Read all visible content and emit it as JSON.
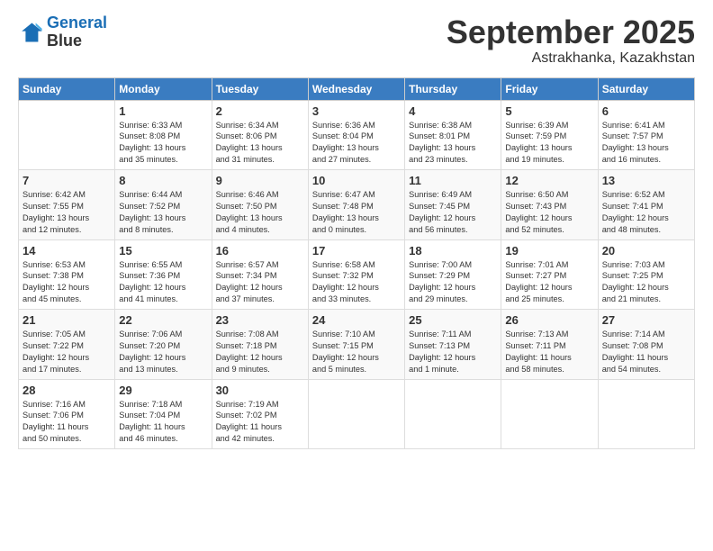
{
  "header": {
    "logo_line1": "General",
    "logo_line2": "Blue",
    "month": "September 2025",
    "location": "Astrakhanka, Kazakhstan"
  },
  "days_of_week": [
    "Sunday",
    "Monday",
    "Tuesday",
    "Wednesday",
    "Thursday",
    "Friday",
    "Saturday"
  ],
  "weeks": [
    [
      {
        "day": "",
        "info": ""
      },
      {
        "day": "1",
        "info": "Sunrise: 6:33 AM\nSunset: 8:08 PM\nDaylight: 13 hours\nand 35 minutes."
      },
      {
        "day": "2",
        "info": "Sunrise: 6:34 AM\nSunset: 8:06 PM\nDaylight: 13 hours\nand 31 minutes."
      },
      {
        "day": "3",
        "info": "Sunrise: 6:36 AM\nSunset: 8:04 PM\nDaylight: 13 hours\nand 27 minutes."
      },
      {
        "day": "4",
        "info": "Sunrise: 6:38 AM\nSunset: 8:01 PM\nDaylight: 13 hours\nand 23 minutes."
      },
      {
        "day": "5",
        "info": "Sunrise: 6:39 AM\nSunset: 7:59 PM\nDaylight: 13 hours\nand 19 minutes."
      },
      {
        "day": "6",
        "info": "Sunrise: 6:41 AM\nSunset: 7:57 PM\nDaylight: 13 hours\nand 16 minutes."
      }
    ],
    [
      {
        "day": "7",
        "info": "Sunrise: 6:42 AM\nSunset: 7:55 PM\nDaylight: 13 hours\nand 12 minutes."
      },
      {
        "day": "8",
        "info": "Sunrise: 6:44 AM\nSunset: 7:52 PM\nDaylight: 13 hours\nand 8 minutes."
      },
      {
        "day": "9",
        "info": "Sunrise: 6:46 AM\nSunset: 7:50 PM\nDaylight: 13 hours\nand 4 minutes."
      },
      {
        "day": "10",
        "info": "Sunrise: 6:47 AM\nSunset: 7:48 PM\nDaylight: 13 hours\nand 0 minutes."
      },
      {
        "day": "11",
        "info": "Sunrise: 6:49 AM\nSunset: 7:45 PM\nDaylight: 12 hours\nand 56 minutes."
      },
      {
        "day": "12",
        "info": "Sunrise: 6:50 AM\nSunset: 7:43 PM\nDaylight: 12 hours\nand 52 minutes."
      },
      {
        "day": "13",
        "info": "Sunrise: 6:52 AM\nSunset: 7:41 PM\nDaylight: 12 hours\nand 48 minutes."
      }
    ],
    [
      {
        "day": "14",
        "info": "Sunrise: 6:53 AM\nSunset: 7:38 PM\nDaylight: 12 hours\nand 45 minutes."
      },
      {
        "day": "15",
        "info": "Sunrise: 6:55 AM\nSunset: 7:36 PM\nDaylight: 12 hours\nand 41 minutes."
      },
      {
        "day": "16",
        "info": "Sunrise: 6:57 AM\nSunset: 7:34 PM\nDaylight: 12 hours\nand 37 minutes."
      },
      {
        "day": "17",
        "info": "Sunrise: 6:58 AM\nSunset: 7:32 PM\nDaylight: 12 hours\nand 33 minutes."
      },
      {
        "day": "18",
        "info": "Sunrise: 7:00 AM\nSunset: 7:29 PM\nDaylight: 12 hours\nand 29 minutes."
      },
      {
        "day": "19",
        "info": "Sunrise: 7:01 AM\nSunset: 7:27 PM\nDaylight: 12 hours\nand 25 minutes."
      },
      {
        "day": "20",
        "info": "Sunrise: 7:03 AM\nSunset: 7:25 PM\nDaylight: 12 hours\nand 21 minutes."
      }
    ],
    [
      {
        "day": "21",
        "info": "Sunrise: 7:05 AM\nSunset: 7:22 PM\nDaylight: 12 hours\nand 17 minutes."
      },
      {
        "day": "22",
        "info": "Sunrise: 7:06 AM\nSunset: 7:20 PM\nDaylight: 12 hours\nand 13 minutes."
      },
      {
        "day": "23",
        "info": "Sunrise: 7:08 AM\nSunset: 7:18 PM\nDaylight: 12 hours\nand 9 minutes."
      },
      {
        "day": "24",
        "info": "Sunrise: 7:10 AM\nSunset: 7:15 PM\nDaylight: 12 hours\nand 5 minutes."
      },
      {
        "day": "25",
        "info": "Sunrise: 7:11 AM\nSunset: 7:13 PM\nDaylight: 12 hours\nand 1 minute."
      },
      {
        "day": "26",
        "info": "Sunrise: 7:13 AM\nSunset: 7:11 PM\nDaylight: 11 hours\nand 58 minutes."
      },
      {
        "day": "27",
        "info": "Sunrise: 7:14 AM\nSunset: 7:08 PM\nDaylight: 11 hours\nand 54 minutes."
      }
    ],
    [
      {
        "day": "28",
        "info": "Sunrise: 7:16 AM\nSunset: 7:06 PM\nDaylight: 11 hours\nand 50 minutes."
      },
      {
        "day": "29",
        "info": "Sunrise: 7:18 AM\nSunset: 7:04 PM\nDaylight: 11 hours\nand 46 minutes."
      },
      {
        "day": "30",
        "info": "Sunrise: 7:19 AM\nSunset: 7:02 PM\nDaylight: 11 hours\nand 42 minutes."
      },
      {
        "day": "",
        "info": ""
      },
      {
        "day": "",
        "info": ""
      },
      {
        "day": "",
        "info": ""
      },
      {
        "day": "",
        "info": ""
      }
    ]
  ]
}
